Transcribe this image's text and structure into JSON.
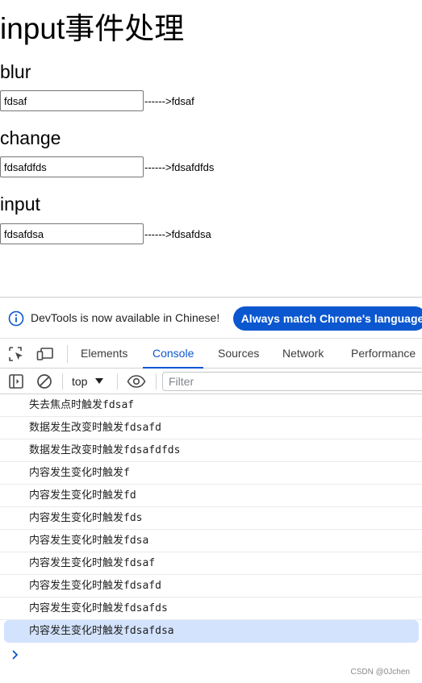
{
  "page": {
    "title": "input事件处理",
    "sections": [
      {
        "heading": "blur",
        "value": "fdsaf",
        "echo": "------>fdsaf"
      },
      {
        "heading": "change",
        "value": "fdsafdfds",
        "echo": "------>fdsafdfds"
      },
      {
        "heading": "input",
        "value": "fdsafdsa",
        "echo": "------>fdsafdsa"
      }
    ]
  },
  "devtools": {
    "infobar": {
      "message": "DevTools is now available in Chinese!",
      "button_label": "Always match Chrome's language"
    },
    "tabs": [
      "Elements",
      "Console",
      "Sources",
      "Network",
      "Performance"
    ],
    "active_tab": "Console",
    "toolbar": {
      "context": "top",
      "filter_placeholder": "Filter"
    },
    "console_logs": [
      "失去焦点时触发fdsaf",
      "数据发生改变时触发fdsafd",
      "数据发生改变时触发fdsafdfds",
      "内容发生变化时触发f",
      "内容发生变化时触发fd",
      "内容发生变化时触发fds",
      "内容发生变化时触发fdsa",
      "内容发生变化时触发fdsaf",
      "内容发生变化时触发fdsafd",
      "内容发生变化时触发fdsafds",
      "内容发生变化时触发fdsafdsa"
    ]
  },
  "watermark": "CSDN @0Jchen",
  "colors": {
    "accent": "#0b57d0",
    "highlight_row": "#d3e3fd"
  }
}
